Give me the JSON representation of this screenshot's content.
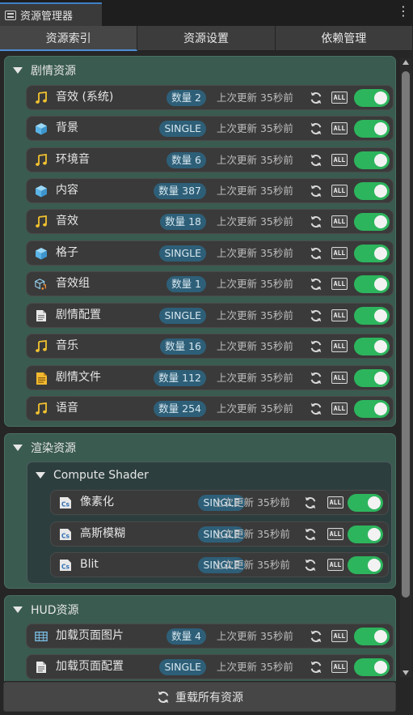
{
  "window": {
    "title": "资源管理器",
    "more_icon": "kebab-menu-icon"
  },
  "tabs": [
    {
      "label": "资源索引",
      "active": true
    },
    {
      "label": "资源设置",
      "active": false
    },
    {
      "label": "依赖管理",
      "active": false
    }
  ],
  "groups": [
    {
      "title": "剧情资源",
      "items": [
        {
          "icon": "music-note-icon",
          "label": "音效 (系统)",
          "badge": "数量 2",
          "updated": "上次更新 35秒前",
          "enabled": true
        },
        {
          "icon": "cube-icon",
          "label": "背景",
          "badge": "SINGLE",
          "updated": "上次更新 35秒前",
          "enabled": true
        },
        {
          "icon": "music-note-icon",
          "label": "环境音",
          "badge": "数量 6",
          "updated": "上次更新 35秒前",
          "enabled": true
        },
        {
          "icon": "cube-icon",
          "label": "内容",
          "badge": "数量 387",
          "updated": "上次更新 35秒前",
          "enabled": true
        },
        {
          "icon": "music-note-icon",
          "label": "音效",
          "badge": "数量 18",
          "updated": "上次更新 35秒前",
          "enabled": true
        },
        {
          "icon": "cube-icon",
          "label": "格子",
          "badge": "SINGLE",
          "updated": "上次更新 35秒前",
          "enabled": true
        },
        {
          "icon": "audio-group-icon",
          "label": "音效组",
          "badge": "数量 1",
          "updated": "上次更新 35秒前",
          "enabled": true
        },
        {
          "icon": "document-icon",
          "label": "剧情配置",
          "badge": "SINGLE",
          "updated": "上次更新 35秒前",
          "enabled": true
        },
        {
          "icon": "music-note-icon",
          "label": "音乐",
          "badge": "数量 16",
          "updated": "上次更新 35秒前",
          "enabled": true
        },
        {
          "icon": "yellow-document-icon",
          "label": "剧情文件",
          "badge": "数量 112",
          "updated": "上次更新 35秒前",
          "enabled": true
        },
        {
          "icon": "music-note-icon",
          "label": "语音",
          "badge": "数量 254",
          "updated": "上次更新 35秒前",
          "enabled": true
        }
      ]
    },
    {
      "title": "渲染资源",
      "subgroup": {
        "title": "Compute Shader",
        "items": [
          {
            "icon": "csharp-script-icon",
            "label": "像素化",
            "badge": "SINGLE",
            "updated": "上次更新 35秒前",
            "enabled": true
          },
          {
            "icon": "csharp-script-icon",
            "label": "高斯模糊",
            "badge": "SINGLE",
            "updated": "上次更新 35秒前",
            "enabled": true
          },
          {
            "icon": "csharp-script-icon",
            "label": "Blit",
            "badge": "SINGLE",
            "updated": "上次更新 35秒前",
            "enabled": true
          }
        ]
      }
    },
    {
      "title": "HUD资源",
      "items": [
        {
          "icon": "image-grid-icon",
          "label": "加载页面图片",
          "badge": "数量 4",
          "updated": "上次更新 35秒前",
          "enabled": true
        },
        {
          "icon": "document-icon",
          "label": "加载页面配置",
          "badge": "SINGLE",
          "updated": "上次更新 35秒前",
          "enabled": true
        }
      ]
    }
  ],
  "all_label": "ALL",
  "footer": {
    "label": "重载所有资源",
    "icon": "refresh-icon"
  },
  "colors": {
    "group_bg": "#3a5b50",
    "badge_bg": "#2e5f78",
    "toggle_on": "#2db55d",
    "music_icon": "#f2c230",
    "cube_icon": "#6cc4f0"
  }
}
